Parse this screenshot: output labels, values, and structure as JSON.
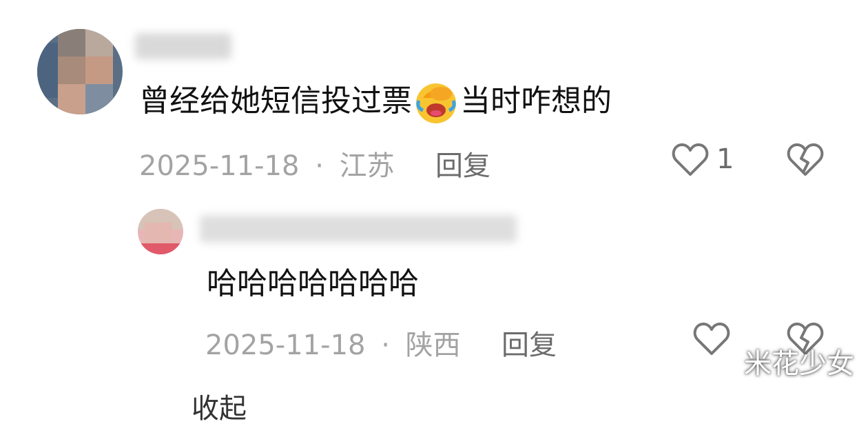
{
  "comments": [
    {
      "text_before": "曾经给她短信投过票",
      "emoji": "face-with-hand-over-eyes-laughing-emoji",
      "text_after": "当时咋想的",
      "date": "2025-11-18",
      "separator": "·",
      "location": "江苏",
      "reply_label": "回复",
      "like_count": "1"
    }
  ],
  "reply": {
    "text": "哈哈哈哈哈哈哈",
    "date": "2025-11-18",
    "separator": "·",
    "location": "陕西",
    "reply_label": "回复"
  },
  "collapse_label": "收起",
  "watermark": "米花少女",
  "icons": {
    "like": "heart-outline-icon",
    "dislike": "broken-heart-icon"
  }
}
